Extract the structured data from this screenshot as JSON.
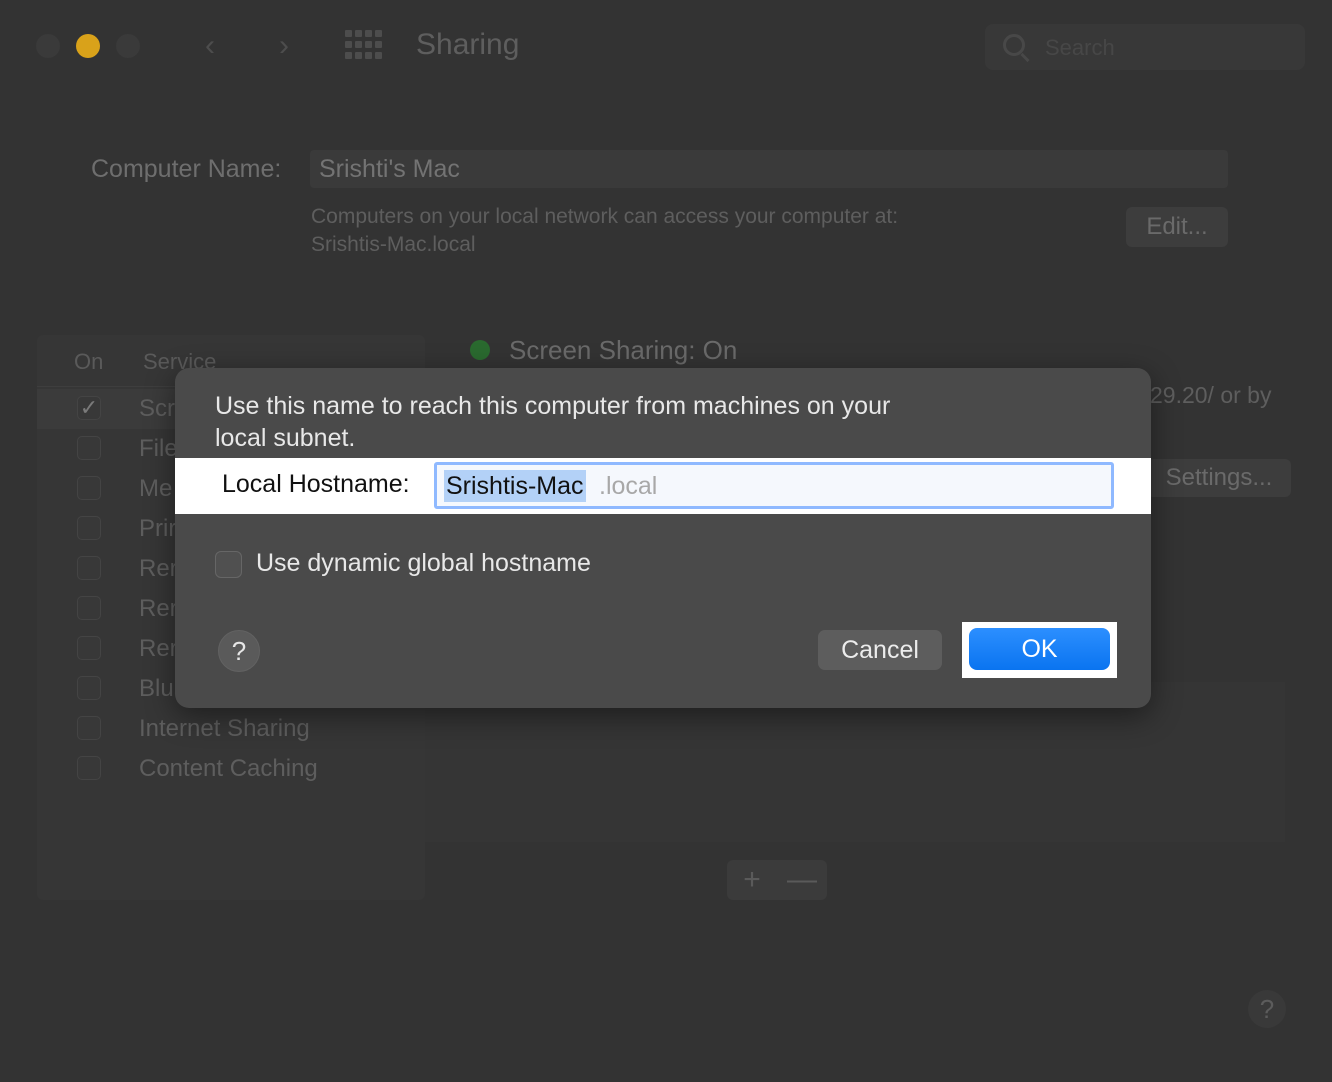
{
  "window": {
    "title": "Sharing",
    "search_placeholder": "Search",
    "nav_back": "‹",
    "nav_forward": "›"
  },
  "computer_name": {
    "label": "Computer Name:",
    "value": "Srishti's Mac",
    "desc_line1": "Computers on your local network can access your computer at:",
    "desc_line2": "Srishtis-Mac.local",
    "edit_button": "Edit..."
  },
  "services": {
    "header_on": "On",
    "header_service": "Service",
    "items": [
      {
        "label": "Scr",
        "checked": true
      },
      {
        "label": "File",
        "checked": false
      },
      {
        "label": "Me",
        "checked": false
      },
      {
        "label": "Prir",
        "checked": false
      },
      {
        "label": "Rer",
        "checked": false
      },
      {
        "label": "Rer",
        "checked": false
      },
      {
        "label": "Rer",
        "checked": false
      },
      {
        "label": "Blu",
        "checked": false
      },
      {
        "label": "Internet Sharing",
        "checked": false
      },
      {
        "label": "Content Caching",
        "checked": false
      }
    ]
  },
  "detail": {
    "status": "Screen Sharing: On",
    "partial_text": "29.20/ or by",
    "settings_button": "Settings...",
    "plus": "+",
    "minus": "—"
  },
  "bg_help": "?",
  "dialog": {
    "message_line1": "Use this name to reach this computer from machines on your",
    "message_line2": "local subnet.",
    "hostname_label": "Local Hostname:",
    "hostname_value": "Srishtis-Mac",
    "hostname_suffix": ".local",
    "dynamic_label": "Use dynamic global hostname",
    "help": "?",
    "cancel": "Cancel",
    "ok": "OK"
  },
  "colors": {
    "accent": "#0a74f0",
    "status_on": "#2a6a2f",
    "selection": "#b3d1f7"
  }
}
